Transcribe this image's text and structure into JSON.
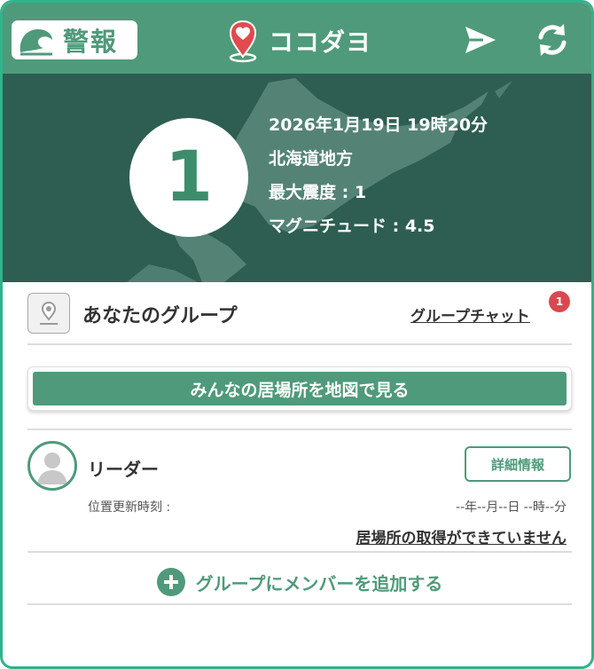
{
  "header": {
    "alert_label": "警報",
    "app_name": "ココダヨ",
    "icons": [
      "wave-icon",
      "location-pin-icon",
      "send-icon",
      "refresh-icon"
    ]
  },
  "quake": {
    "intensity": "1",
    "datetime": "2026年1月19日 19時20分",
    "region": "北海道地方",
    "max_intensity": "最大震度 : 1",
    "magnitude": "マグニチュード : 4.5"
  },
  "group": {
    "title": "あなたのグループ",
    "chat_link": "グループチャット",
    "chat_badge": "1",
    "map_button": "みんなの居場所を地図で見る"
  },
  "member": {
    "name": "リーダー",
    "detail_button": "詳細情報",
    "update_label": "位置更新時刻 :",
    "update_value": "--年--月--日 --時--分",
    "location_status": "居場所の取得ができていません"
  },
  "add_member": {
    "label": "グループにメンバーを追加する"
  },
  "colors": {
    "primary": "#4f9a7a",
    "hero_bg": "#2e5e51",
    "frame_border": "#2fb48c",
    "badge_red": "#d9484f",
    "pin_red": "#e24a4f"
  }
}
